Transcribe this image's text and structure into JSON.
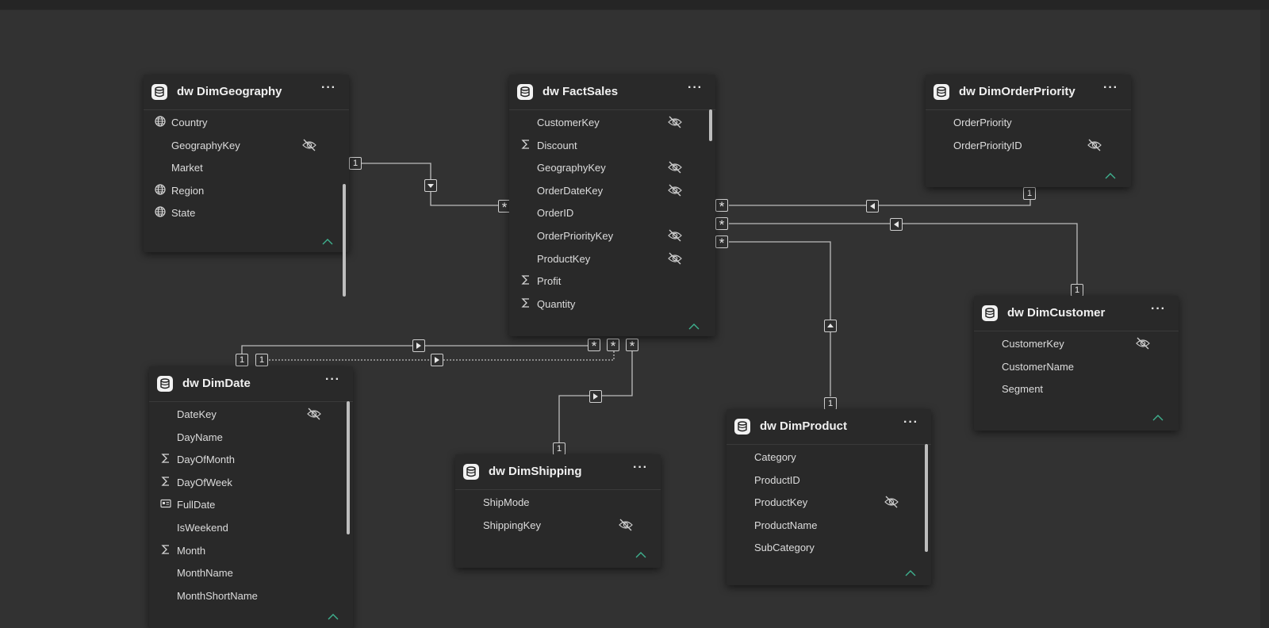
{
  "tables": {
    "geography": {
      "title": "dw DimGeography",
      "fields": [
        {
          "name": "Country",
          "icon": "globe-icon",
          "hidden": false
        },
        {
          "name": "GeographyKey",
          "icon": "",
          "hidden": true
        },
        {
          "name": "Market",
          "icon": "",
          "hidden": false
        },
        {
          "name": "Region",
          "icon": "globe-icon",
          "hidden": false
        },
        {
          "name": "State",
          "icon": "globe-icon",
          "hidden": false
        }
      ]
    },
    "fact": {
      "title": "dw FactSales",
      "fields": [
        {
          "name": "CustomerKey",
          "icon": "",
          "hidden": true
        },
        {
          "name": "Discount",
          "icon": "sigma-icon",
          "hidden": false
        },
        {
          "name": "GeographyKey",
          "icon": "",
          "hidden": true
        },
        {
          "name": "OrderDateKey",
          "icon": "",
          "hidden": true
        },
        {
          "name": "OrderID",
          "icon": "",
          "hidden": false
        },
        {
          "name": "OrderPriorityKey",
          "icon": "",
          "hidden": true
        },
        {
          "name": "ProductKey",
          "icon": "",
          "hidden": true
        },
        {
          "name": "Profit",
          "icon": "sigma-icon",
          "hidden": false
        },
        {
          "name": "Quantity",
          "icon": "sigma-icon",
          "hidden": false
        }
      ]
    },
    "orderpriority": {
      "title": "dw DimOrderPriority",
      "fields": [
        {
          "name": "OrderPriority",
          "icon": "",
          "hidden": false
        },
        {
          "name": "OrderPriorityID",
          "icon": "",
          "hidden": true
        }
      ]
    },
    "customer": {
      "title": "dw DimCustomer",
      "fields": [
        {
          "name": "CustomerKey",
          "icon": "",
          "hidden": true
        },
        {
          "name": "CustomerName",
          "icon": "",
          "hidden": false
        },
        {
          "name": "Segment",
          "icon": "",
          "hidden": false
        }
      ]
    },
    "date": {
      "title": "dw DimDate",
      "fields": [
        {
          "name": "DateKey",
          "icon": "",
          "hidden": true
        },
        {
          "name": "DayName",
          "icon": "",
          "hidden": false
        },
        {
          "name": "DayOfMonth",
          "icon": "sigma-icon",
          "hidden": false
        },
        {
          "name": "DayOfWeek",
          "icon": "sigma-icon",
          "hidden": false
        },
        {
          "name": "FullDate",
          "icon": "calendar-icon",
          "hidden": false
        },
        {
          "name": "IsWeekend",
          "icon": "",
          "hidden": false
        },
        {
          "name": "Month",
          "icon": "sigma-icon",
          "hidden": false
        },
        {
          "name": "MonthName",
          "icon": "",
          "hidden": false
        },
        {
          "name": "MonthShortName",
          "icon": "",
          "hidden": false
        }
      ]
    },
    "shipping": {
      "title": "dw DimShipping",
      "fields": [
        {
          "name": "ShipMode",
          "icon": "",
          "hidden": false
        },
        {
          "name": "ShippingKey",
          "icon": "",
          "hidden": true
        }
      ]
    },
    "product": {
      "title": "dw DimProduct",
      "fields": [
        {
          "name": "Category",
          "icon": "",
          "hidden": false
        },
        {
          "name": "ProductID",
          "icon": "",
          "hidden": false
        },
        {
          "name": "ProductKey",
          "icon": "",
          "hidden": true
        },
        {
          "name": "ProductName",
          "icon": "",
          "hidden": false
        },
        {
          "name": "SubCategory",
          "icon": "",
          "hidden": false
        }
      ]
    }
  },
  "cardinality": {
    "one": "1",
    "many": "*"
  },
  "more_label": "···",
  "colors": {
    "canvas": "#323232",
    "card": "#292929",
    "line": "#bdbdbd",
    "collapse_accent": "#3fb28f"
  }
}
